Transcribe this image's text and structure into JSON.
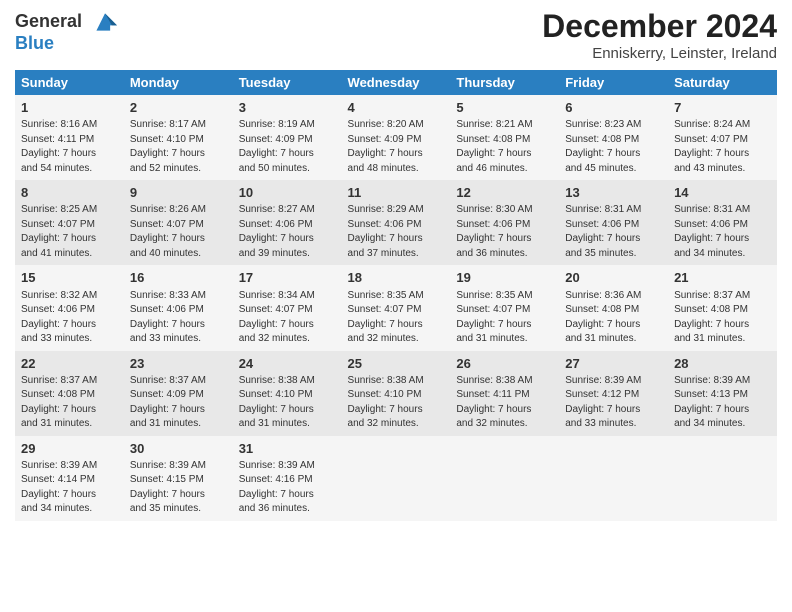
{
  "header": {
    "logo_line1": "General",
    "logo_line2": "Blue",
    "month": "December 2024",
    "location": "Enniskerry, Leinster, Ireland"
  },
  "days_of_week": [
    "Sunday",
    "Monday",
    "Tuesday",
    "Wednesday",
    "Thursday",
    "Friday",
    "Saturday"
  ],
  "weeks": [
    [
      {
        "day": "1",
        "lines": [
          "Sunrise: 8:16 AM",
          "Sunset: 4:11 PM",
          "Daylight: 7 hours",
          "and 54 minutes."
        ]
      },
      {
        "day": "2",
        "lines": [
          "Sunrise: 8:17 AM",
          "Sunset: 4:10 PM",
          "Daylight: 7 hours",
          "and 52 minutes."
        ]
      },
      {
        "day": "3",
        "lines": [
          "Sunrise: 8:19 AM",
          "Sunset: 4:09 PM",
          "Daylight: 7 hours",
          "and 50 minutes."
        ]
      },
      {
        "day": "4",
        "lines": [
          "Sunrise: 8:20 AM",
          "Sunset: 4:09 PM",
          "Daylight: 7 hours",
          "and 48 minutes."
        ]
      },
      {
        "day": "5",
        "lines": [
          "Sunrise: 8:21 AM",
          "Sunset: 4:08 PM",
          "Daylight: 7 hours",
          "and 46 minutes."
        ]
      },
      {
        "day": "6",
        "lines": [
          "Sunrise: 8:23 AM",
          "Sunset: 4:08 PM",
          "Daylight: 7 hours",
          "and 45 minutes."
        ]
      },
      {
        "day": "7",
        "lines": [
          "Sunrise: 8:24 AM",
          "Sunset: 4:07 PM",
          "Daylight: 7 hours",
          "and 43 minutes."
        ]
      }
    ],
    [
      {
        "day": "8",
        "lines": [
          "Sunrise: 8:25 AM",
          "Sunset: 4:07 PM",
          "Daylight: 7 hours",
          "and 41 minutes."
        ]
      },
      {
        "day": "9",
        "lines": [
          "Sunrise: 8:26 AM",
          "Sunset: 4:07 PM",
          "Daylight: 7 hours",
          "and 40 minutes."
        ]
      },
      {
        "day": "10",
        "lines": [
          "Sunrise: 8:27 AM",
          "Sunset: 4:06 PM",
          "Daylight: 7 hours",
          "and 39 minutes."
        ]
      },
      {
        "day": "11",
        "lines": [
          "Sunrise: 8:29 AM",
          "Sunset: 4:06 PM",
          "Daylight: 7 hours",
          "and 37 minutes."
        ]
      },
      {
        "day": "12",
        "lines": [
          "Sunrise: 8:30 AM",
          "Sunset: 4:06 PM",
          "Daylight: 7 hours",
          "and 36 minutes."
        ]
      },
      {
        "day": "13",
        "lines": [
          "Sunrise: 8:31 AM",
          "Sunset: 4:06 PM",
          "Daylight: 7 hours",
          "and 35 minutes."
        ]
      },
      {
        "day": "14",
        "lines": [
          "Sunrise: 8:31 AM",
          "Sunset: 4:06 PM",
          "Daylight: 7 hours",
          "and 34 minutes."
        ]
      }
    ],
    [
      {
        "day": "15",
        "lines": [
          "Sunrise: 8:32 AM",
          "Sunset: 4:06 PM",
          "Daylight: 7 hours",
          "and 33 minutes."
        ]
      },
      {
        "day": "16",
        "lines": [
          "Sunrise: 8:33 AM",
          "Sunset: 4:06 PM",
          "Daylight: 7 hours",
          "and 33 minutes."
        ]
      },
      {
        "day": "17",
        "lines": [
          "Sunrise: 8:34 AM",
          "Sunset: 4:07 PM",
          "Daylight: 7 hours",
          "and 32 minutes."
        ]
      },
      {
        "day": "18",
        "lines": [
          "Sunrise: 8:35 AM",
          "Sunset: 4:07 PM",
          "Daylight: 7 hours",
          "and 32 minutes."
        ]
      },
      {
        "day": "19",
        "lines": [
          "Sunrise: 8:35 AM",
          "Sunset: 4:07 PM",
          "Daylight: 7 hours",
          "and 31 minutes."
        ]
      },
      {
        "day": "20",
        "lines": [
          "Sunrise: 8:36 AM",
          "Sunset: 4:08 PM",
          "Daylight: 7 hours",
          "and 31 minutes."
        ]
      },
      {
        "day": "21",
        "lines": [
          "Sunrise: 8:37 AM",
          "Sunset: 4:08 PM",
          "Daylight: 7 hours",
          "and 31 minutes."
        ]
      }
    ],
    [
      {
        "day": "22",
        "lines": [
          "Sunrise: 8:37 AM",
          "Sunset: 4:08 PM",
          "Daylight: 7 hours",
          "and 31 minutes."
        ]
      },
      {
        "day": "23",
        "lines": [
          "Sunrise: 8:37 AM",
          "Sunset: 4:09 PM",
          "Daylight: 7 hours",
          "and 31 minutes."
        ]
      },
      {
        "day": "24",
        "lines": [
          "Sunrise: 8:38 AM",
          "Sunset: 4:10 PM",
          "Daylight: 7 hours",
          "and 31 minutes."
        ]
      },
      {
        "day": "25",
        "lines": [
          "Sunrise: 8:38 AM",
          "Sunset: 4:10 PM",
          "Daylight: 7 hours",
          "and 32 minutes."
        ]
      },
      {
        "day": "26",
        "lines": [
          "Sunrise: 8:38 AM",
          "Sunset: 4:11 PM",
          "Daylight: 7 hours",
          "and 32 minutes."
        ]
      },
      {
        "day": "27",
        "lines": [
          "Sunrise: 8:39 AM",
          "Sunset: 4:12 PM",
          "Daylight: 7 hours",
          "and 33 minutes."
        ]
      },
      {
        "day": "28",
        "lines": [
          "Sunrise: 8:39 AM",
          "Sunset: 4:13 PM",
          "Daylight: 7 hours",
          "and 34 minutes."
        ]
      }
    ],
    [
      {
        "day": "29",
        "lines": [
          "Sunrise: 8:39 AM",
          "Sunset: 4:14 PM",
          "Daylight: 7 hours",
          "and 34 minutes."
        ]
      },
      {
        "day": "30",
        "lines": [
          "Sunrise: 8:39 AM",
          "Sunset: 4:15 PM",
          "Daylight: 7 hours",
          "and 35 minutes."
        ]
      },
      {
        "day": "31",
        "lines": [
          "Sunrise: 8:39 AM",
          "Sunset: 4:16 PM",
          "Daylight: 7 hours",
          "and 36 minutes."
        ]
      },
      null,
      null,
      null,
      null
    ]
  ]
}
